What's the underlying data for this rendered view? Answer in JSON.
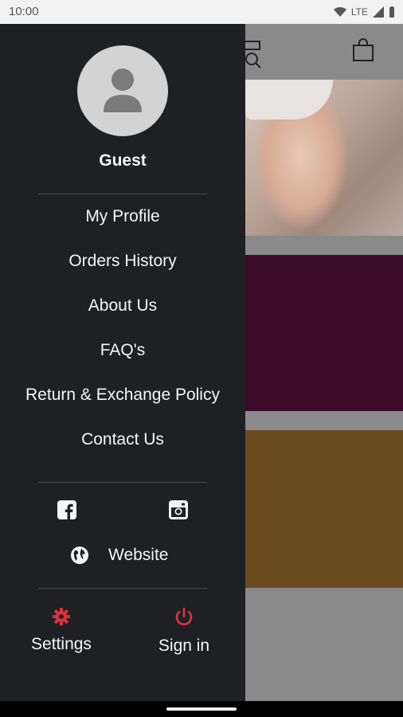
{
  "status_bar": {
    "time": "10:00",
    "network": "LTE"
  },
  "drawer": {
    "user_name": "Guest",
    "menu": [
      {
        "label": "My Profile"
      },
      {
        "label": "Orders History"
      },
      {
        "label": "About Us"
      },
      {
        "label": "FAQ's"
      },
      {
        "label": "Return & Exchange Policy"
      },
      {
        "label": "Contact Us"
      }
    ],
    "website_label": "Website",
    "settings_label": "Settings",
    "signin_label": "Sign in"
  },
  "colors": {
    "drawer_bg": "#1f2024",
    "accent": "#e0313d",
    "promo_plum": "#3d0c2a",
    "promo_mustard": "#6b4a1e"
  }
}
